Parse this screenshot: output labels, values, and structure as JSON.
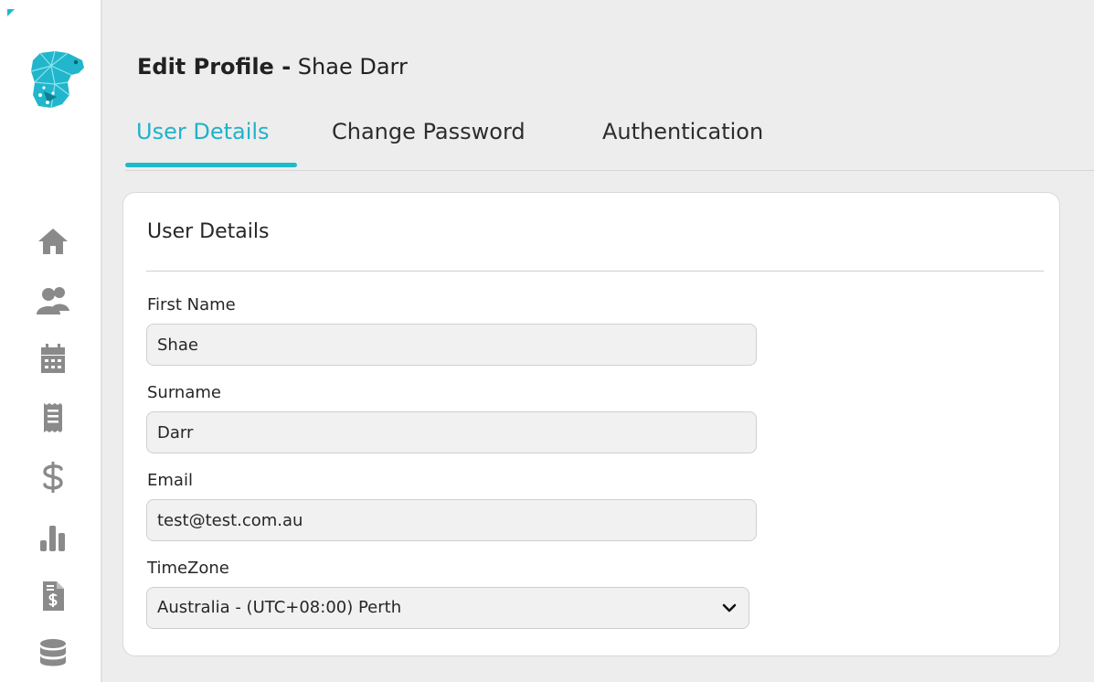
{
  "page": {
    "title_prefix": "Edit Profile -",
    "title_name": "Shae Darr"
  },
  "sidebar": {
    "logo": "dog-head-logo",
    "items": [
      {
        "icon": "home-icon"
      },
      {
        "icon": "users-icon"
      },
      {
        "icon": "calendar-icon"
      },
      {
        "icon": "receipt-icon"
      },
      {
        "icon": "dollar-icon"
      },
      {
        "icon": "bar-chart-icon"
      },
      {
        "icon": "invoice-icon"
      },
      {
        "icon": "database-icon"
      }
    ]
  },
  "tabs": [
    {
      "label": "User Details",
      "active": true
    },
    {
      "label": "Change Password",
      "active": false
    },
    {
      "label": "Authentication",
      "active": false
    }
  ],
  "card": {
    "title": "User Details",
    "fields": {
      "first_name": {
        "label": "First Name",
        "value": "Shae"
      },
      "surname": {
        "label": "Surname",
        "value": "Darr"
      },
      "email": {
        "label": "Email",
        "value": "test@test.com.au"
      },
      "timezone": {
        "label": "TimeZone",
        "value": "Australia  -  (UTC+08:00) Perth"
      }
    }
  },
  "colors": {
    "accent": "#1fb9cc",
    "nav_icon": "#8a8a8a",
    "background": "#ededed"
  }
}
